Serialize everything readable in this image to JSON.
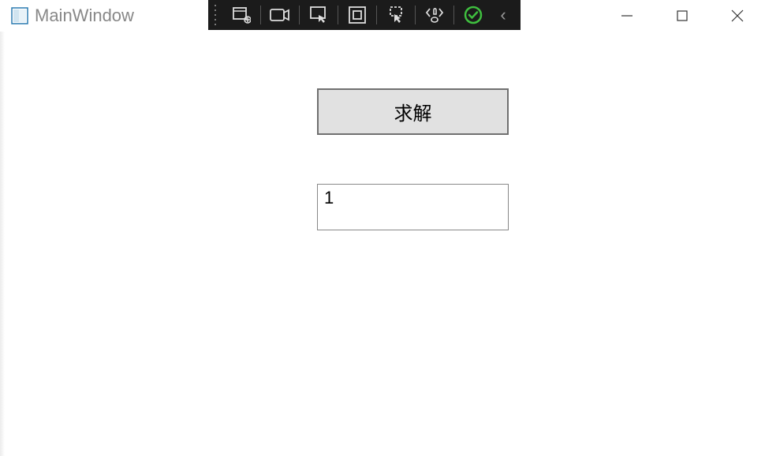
{
  "window": {
    "title": "MainWindow"
  },
  "debug_toolbar": {
    "items": [
      "target",
      "camera",
      "select-element",
      "layout",
      "select-layout",
      "hot-reload",
      "apply"
    ],
    "collapse_glyph": "‹"
  },
  "main": {
    "solve_button_label": "求解",
    "result_value": "1"
  }
}
